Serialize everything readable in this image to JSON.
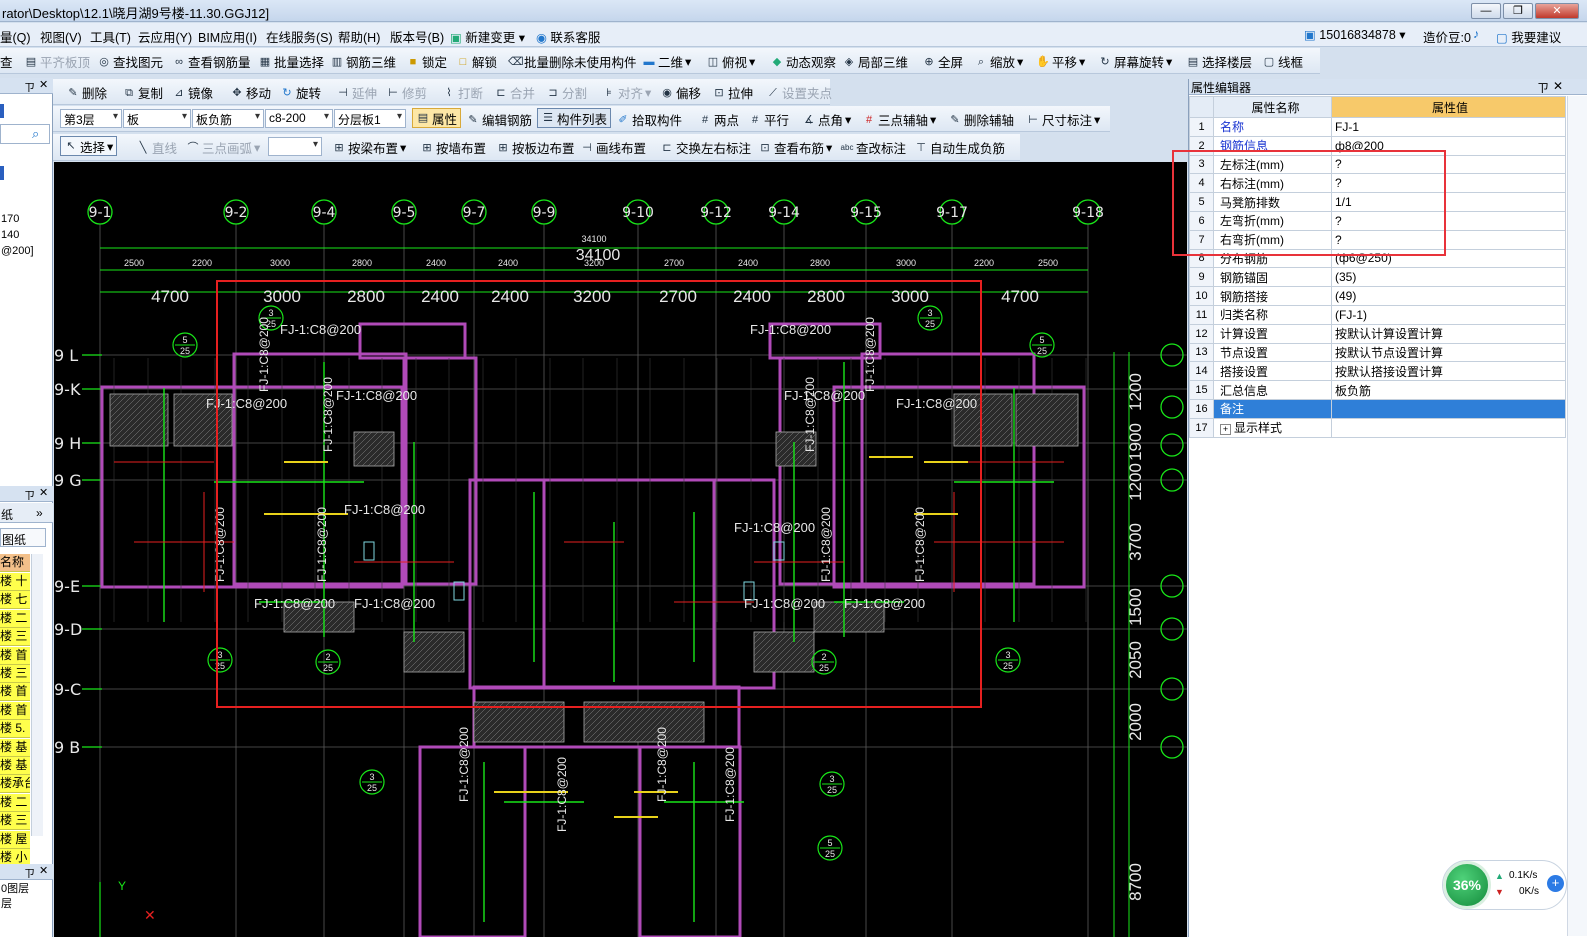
{
  "title": "rator\\Desktop\\12.1\\晓月湖9号楼-11.30.GGJ12]",
  "window_buttons": [
    "—",
    "❐",
    "✕"
  ],
  "menu": [
    "量(Q)",
    "视图(V)",
    "工具(T)",
    "云应用(Y)",
    "BIM应用(I)",
    "在线服务(S)",
    "帮助(H)",
    "版本号(B)",
    "新建变更",
    "联系客服"
  ],
  "account": {
    "phone": "15016834878",
    "coins": "造价豆:0",
    "suggest": "我要建议"
  },
  "toolbar1": [
    "查",
    "平齐板顶",
    "查找图元",
    "查看钢筋量",
    "批量选择",
    "钢筋三维",
    "锁定",
    "解锁",
    "批量删除未使用构件",
    "二维",
    "俯视",
    "动态观察",
    "局部三维",
    "全屏",
    "缩放",
    "平移",
    "屏幕旋转",
    "选择楼层",
    "线框"
  ],
  "toolbar2": [
    "删除",
    "复制",
    "镜像",
    "移动",
    "旋转",
    "延伸",
    "修剪",
    "打断",
    "合并",
    "分割",
    "对齐",
    "偏移",
    "拉伸",
    "设置夹点"
  ],
  "toolbar3": {
    "floor": "第3层",
    "type": "板",
    "sub": "板负筋",
    "spec": "c8-200",
    "layer": "分层板1",
    "items": [
      "属性",
      "编辑钢筋",
      "构件列表",
      "拾取构件",
      "两点",
      "平行",
      "点角",
      "三点辅轴",
      "删除辅轴",
      "尺寸标注"
    ]
  },
  "toolbar4": [
    "选择",
    "直线",
    "三点画弧",
    "按梁布置",
    "按墙布置",
    "按板边布置",
    "画线布置",
    "交换左右标注",
    "查看布筋",
    "查改标注",
    "自动生成负筋"
  ],
  "left_panel": {
    "values": [
      "170",
      "140",
      "@200]"
    ],
    "head2": "纸",
    "tab": "图纸",
    "col": "名称",
    "rows": [
      "楼 十",
      "楼 七",
      "楼 二",
      "楼 三",
      "楼 首",
      "楼 三",
      "楼 首",
      "楼 首",
      "楼 5.",
      "楼 基",
      "楼 基",
      "楼承台",
      "楼 二",
      "楼 三",
      "楼 屋",
      "楼 小"
    ],
    "bottom": [
      "0图层",
      "层"
    ]
  },
  "props": {
    "title": "属性编辑器",
    "col_name": "属性名称",
    "col_value": "属性值",
    "rows": [
      {
        "n": "1",
        "k": "名称",
        "v": "FJ-1"
      },
      {
        "n": "2",
        "k": "钢筋信息",
        "v": "ф8@200"
      },
      {
        "n": "3",
        "k": "左标注(mm)",
        "v": "?"
      },
      {
        "n": "4",
        "k": "右标注(mm)",
        "v": "?"
      },
      {
        "n": "5",
        "k": "马凳筋排数",
        "v": "1/1"
      },
      {
        "n": "6",
        "k": "左弯折(mm)",
        "v": "?"
      },
      {
        "n": "7",
        "k": "右弯折(mm)",
        "v": "?"
      },
      {
        "n": "8",
        "k": "分布钢筋",
        "v": "(ф6@250)"
      },
      {
        "n": "9",
        "k": "钢筋锚固",
        "v": "(35)"
      },
      {
        "n": "10",
        "k": "钢筋搭接",
        "v": "(49)"
      },
      {
        "n": "11",
        "k": "归类名称",
        "v": "(FJ-1)"
      },
      {
        "n": "12",
        "k": "计算设置",
        "v": "按默认计算设置计算"
      },
      {
        "n": "13",
        "k": "节点设置",
        "v": "按默认节点设置计算"
      },
      {
        "n": "14",
        "k": "搭接设置",
        "v": "按默认搭接设置计算"
      },
      {
        "n": "15",
        "k": "汇总信息",
        "v": "板负筋"
      },
      {
        "n": "16",
        "k": "备注",
        "v": ""
      },
      {
        "n": "17",
        "k": "显示样式",
        "v": ""
      }
    ]
  },
  "drawing": {
    "axes_top": [
      "9-1",
      "9-2",
      "9-4",
      "9-5",
      "9-7",
      "9-9",
      "9-10",
      "9-12",
      "9-14",
      "9-15",
      "9-17",
      "9-18"
    ],
    "axes_left": [
      "9 L",
      "9-K",
      "9 H",
      "9 G",
      "9-E",
      "9-D",
      "9-C",
      "9 B"
    ],
    "total_dim": "34100",
    "dims_small": [
      "2500",
      "2200",
      "3000",
      "2800",
      "2400",
      "2400",
      "3200",
      "2700",
      "2400",
      "2800",
      "3000",
      "2200",
      "2500"
    ],
    "dims_big": [
      "4700",
      "3000",
      "2800",
      "2400",
      "2400",
      "3200",
      "2700",
      "2400",
      "2800",
      "3000",
      "4700"
    ],
    "right_dims": [
      "1200",
      "1900",
      "1200",
      "3700",
      "1500",
      "2050",
      "2000",
      "8700"
    ],
    "labels": [
      "FJ-1:C8@200",
      "FJ-1:C8@200",
      "FJ-1:C8@200",
      "FJ-1:C8@200",
      "FJ-1:C8@200",
      "FJ-1:C8@200",
      "FJ-1:C8@200",
      "FJ-1:C8@200",
      "FJ-1:C8@200",
      "FJ-1:C8@200"
    ]
  },
  "network": {
    "pct": "36%",
    "up": "0.1K/s",
    "down": "0K/s"
  }
}
